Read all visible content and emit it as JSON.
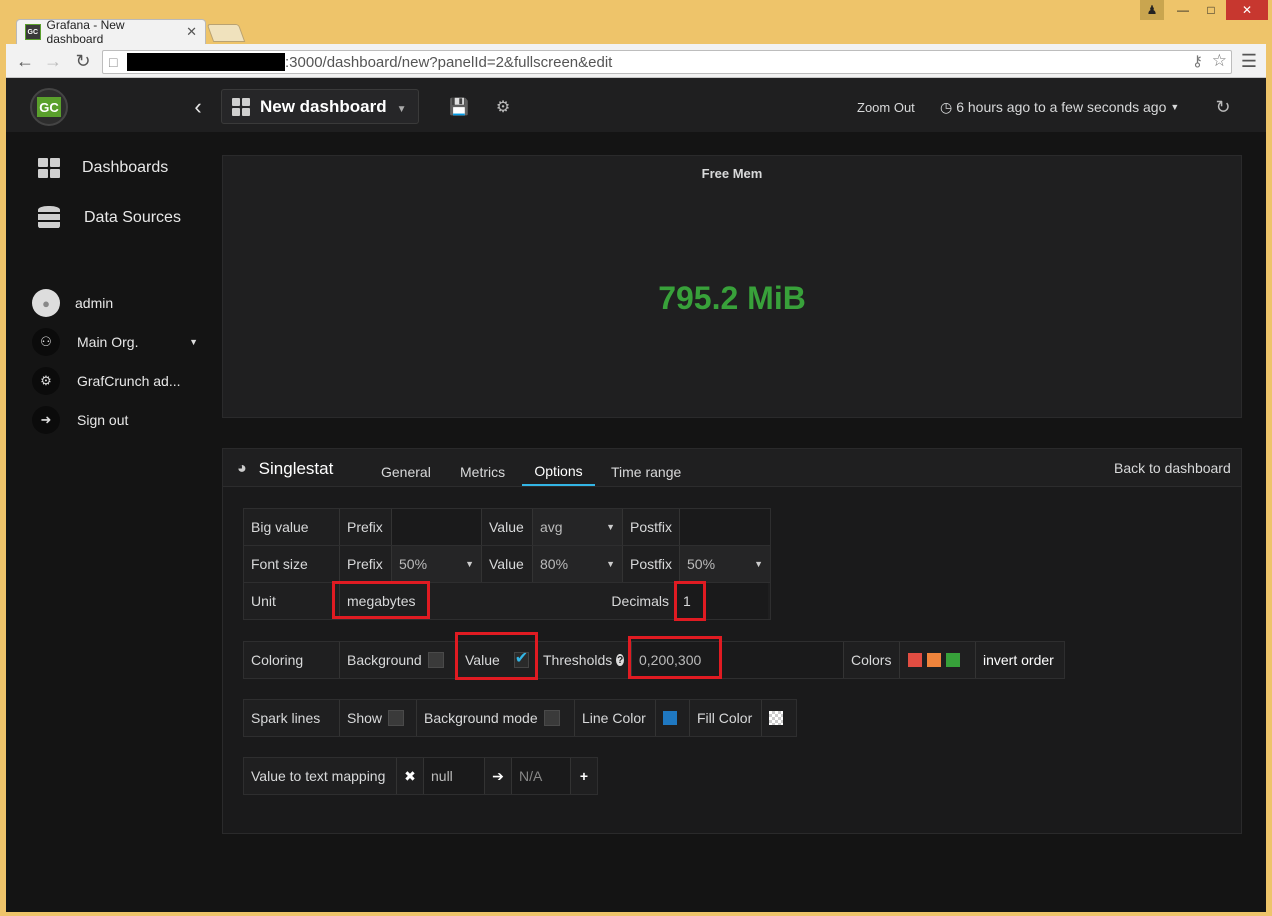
{
  "browser": {
    "tab_title": "Grafana - New dashboard",
    "tab_favicon_text": "GC",
    "url_visible": ":3000/dashboard/new?panelId=2&fullscreen&edit"
  },
  "topnav": {
    "logo_text": "GC",
    "dashboard_title": "New dashboard",
    "zoom_out": "Zoom Out",
    "time_range": "6 hours ago to a few seconds ago"
  },
  "sidebar": {
    "items": [
      {
        "label": "Dashboards",
        "icon": "grid-icon"
      },
      {
        "label": "Data Sources",
        "icon": "database-icon"
      }
    ],
    "user": "admin",
    "org": "Main Org.",
    "admin": "GrafCrunch ad...",
    "signout": "Sign out"
  },
  "panel": {
    "title": "Free Mem",
    "value": "795.2 MiB",
    "value_color": "#38a13a"
  },
  "editor": {
    "panel_type": "Singlestat",
    "tabs": [
      "General",
      "Metrics",
      "Options",
      "Time range"
    ],
    "active_tab": "Options",
    "back": "Back to dashboard",
    "big_value": {
      "label": "Big value",
      "prefix_label": "Prefix",
      "prefix": "",
      "value_label": "Value",
      "value": "avg",
      "postfix_label": "Postfix",
      "postfix": ""
    },
    "font_size": {
      "label": "Font size",
      "prefix_label": "Prefix",
      "prefix": "50%",
      "value_label": "Value",
      "value": "80%",
      "postfix_label": "Postfix",
      "postfix": "50%"
    },
    "unit": {
      "label": "Unit",
      "value": "megabytes",
      "decimals_label": "Decimals",
      "decimals": "1"
    },
    "coloring": {
      "label": "Coloring",
      "background_label": "Background",
      "value_label": "Value",
      "thresholds_label": "Thresholds",
      "thresholds": "0,200,300",
      "colors_label": "Colors",
      "colors": [
        "#e24d42",
        "#ef843c",
        "#37a13a"
      ],
      "invert": "invert order"
    },
    "spark": {
      "label": "Spark lines",
      "show_label": "Show",
      "bgmode_label": "Background mode",
      "line_label": "Line Color",
      "line_color": "#1f78c1",
      "fill_label": "Fill Color"
    },
    "mapping": {
      "label": "Value to text mapping",
      "from": "null",
      "to": "N/A"
    }
  }
}
